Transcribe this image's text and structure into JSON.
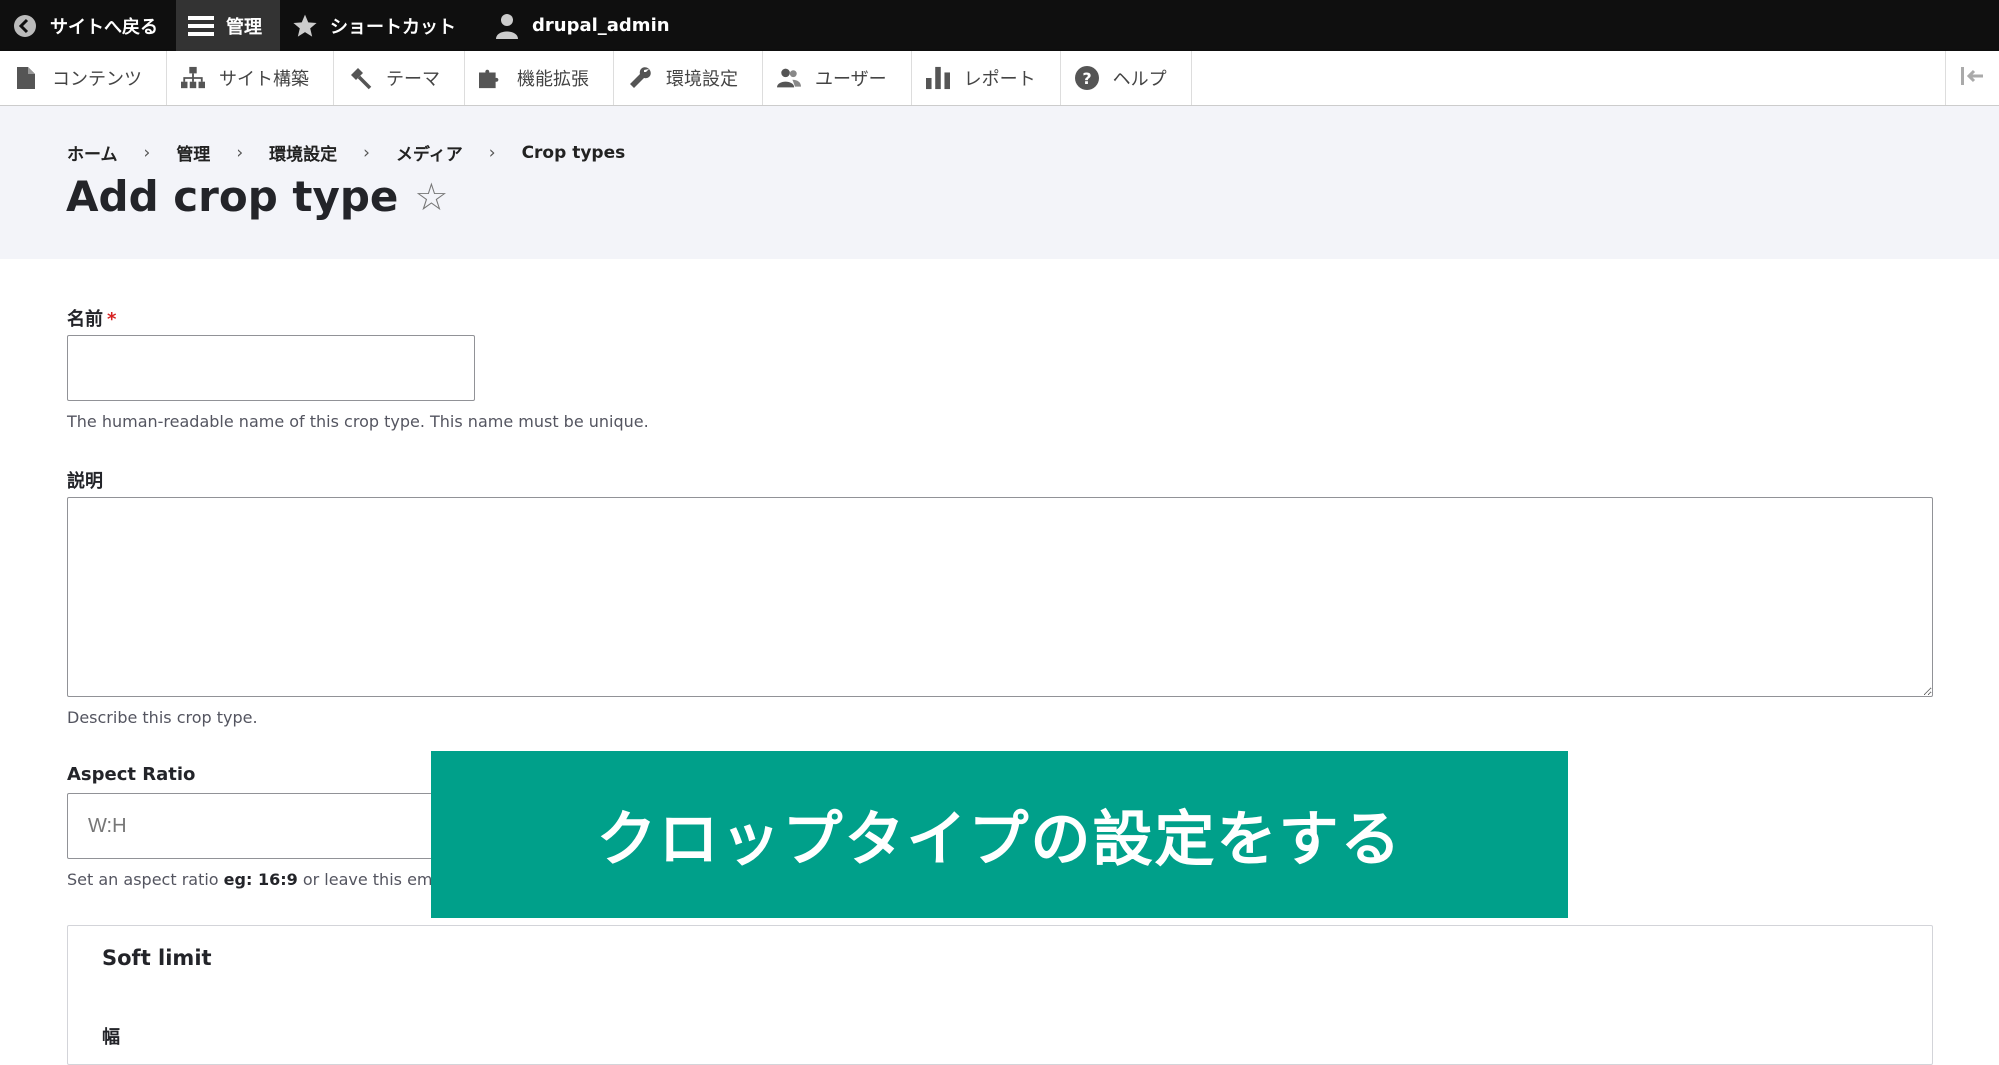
{
  "toolbar": {
    "back": "サイトへ戻る",
    "manage": "管理",
    "shortcuts": "ショートカット",
    "user": "drupal_admin"
  },
  "tray": {
    "items": [
      {
        "label": "コンテンツ",
        "icon": "file-icon"
      },
      {
        "label": "サイト構築",
        "icon": "sitemap-icon"
      },
      {
        "label": "テーマ",
        "icon": "paintbrush-icon"
      },
      {
        "label": "機能拡張",
        "icon": "puzzle-icon"
      },
      {
        "label": "環境設定",
        "icon": "wrench-icon"
      },
      {
        "label": "ユーザー",
        "icon": "users-icon"
      },
      {
        "label": "レポート",
        "icon": "bar-chart-icon"
      },
      {
        "label": "ヘルプ",
        "icon": "help-icon"
      }
    ]
  },
  "breadcrumb": [
    "ホーム",
    "管理",
    "環境設定",
    "メディア",
    "Crop types"
  ],
  "page": {
    "title": "Add crop type"
  },
  "form": {
    "name_label": "名前",
    "name_required": "*",
    "name_value": "",
    "name_desc": "The human-readable name of this crop type. This name must be unique.",
    "description_label": "説明",
    "description_value": "",
    "description_desc": "Describe this crop type.",
    "aspect_label": "Aspect Ratio",
    "aspect_placeholder": "W:H",
    "aspect_desc_pre": "Set an aspect ratio ",
    "aspect_desc_bold": "eg: 16:9",
    "aspect_desc_post": " or leave this em",
    "soft_limit_legend": "Soft limit",
    "soft_limit_width_label": "幅"
  },
  "banner": {
    "text": "クロップタイプの設定をする"
  },
  "colors": {
    "toolbar_bg": "#0f0f0f",
    "banner_bg": "#00a08a",
    "header_bg": "#f3f4f9",
    "required": "#d72222"
  }
}
